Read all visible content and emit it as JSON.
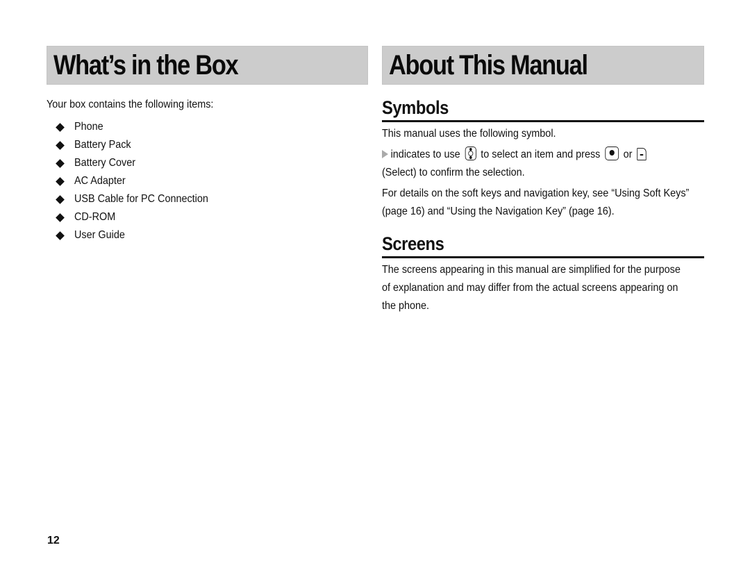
{
  "page_number": "12",
  "left": {
    "title": "What’s in the Box",
    "intro": "Your box contains the following items:",
    "items": [
      "Phone",
      "Battery Pack",
      "Battery Cover",
      "AC Adapter",
      "USB Cable for PC Connection",
      "CD-ROM",
      "User Guide"
    ]
  },
  "right": {
    "title": "About This Manual",
    "symbols": {
      "heading": "Symbols",
      "intro": "This manual uses the following symbol.",
      "symbol_line": {
        "part1": "indicates to use",
        "part2": "to select an item and press",
        "part3": "or",
        "part4": "(Select) to confirm the selection.",
        "icons": [
          "triangle-pointer-icon",
          "navigation-key-icon",
          "center-key-icon",
          "soft-key-icon"
        ]
      },
      "details_line1": "For details on the soft keys and navigation key, see “Using Soft Keys”",
      "details_line2": "(page 16) and “Using the Navigation Key” (page 16)."
    },
    "screens": {
      "heading": "Screens",
      "line1": "The screens appearing in this manual are simplified for the purpose",
      "line2": "of explanation and may differ from the actual screens appearing on",
      "line3": "the phone."
    }
  }
}
